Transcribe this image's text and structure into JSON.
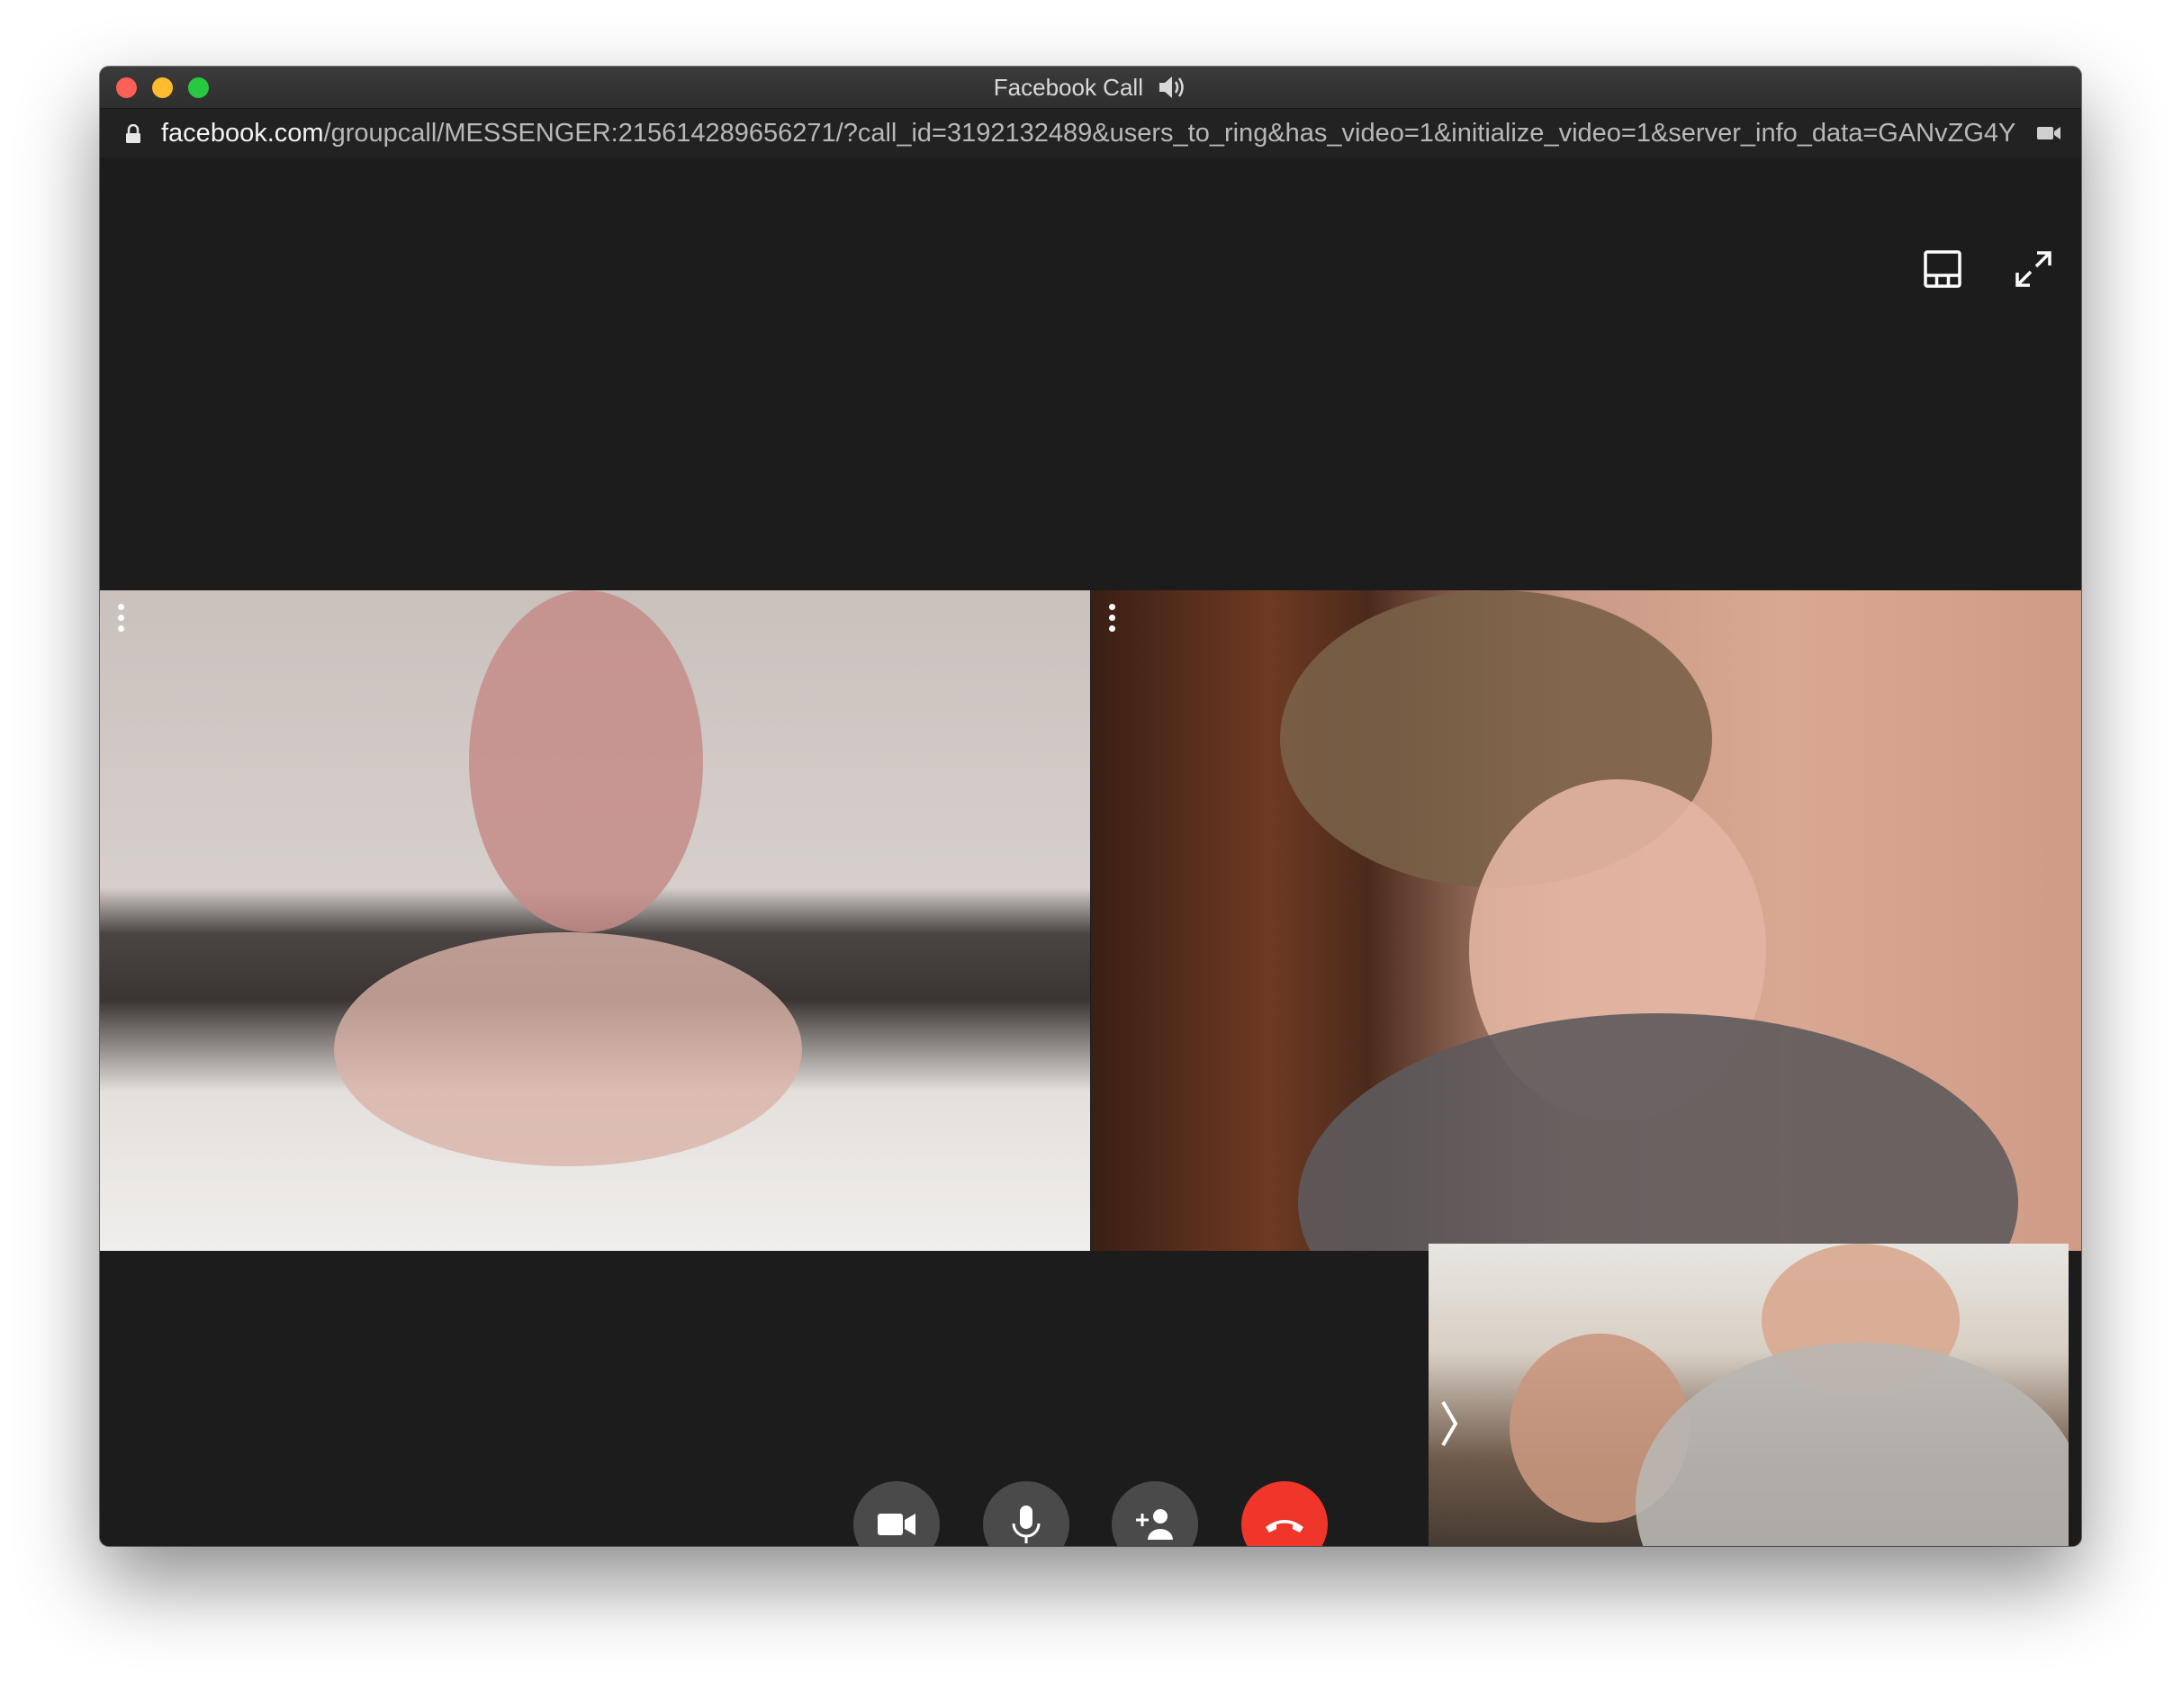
{
  "window": {
    "title": "Facebook Call",
    "title_icon": "speaker-icon"
  },
  "address_bar": {
    "lock_icon": "lock-icon",
    "host": "facebook.com",
    "path": "/groupcall/MESSENGER:215614289656271/?call_id=3192132489&users_to_ring&has_video=1&initialize_video=1&server_info_data=GANvZG4YGU1...",
    "camera_icon": "camera-icon"
  },
  "top_controls": {
    "layout_icon": "layout-icon",
    "fullscreen_icon": "expand-icon"
  },
  "participants": [
    {
      "menu_icon": "more-vertical-icon"
    },
    {
      "menu_icon": "more-vertical-icon"
    },
    {
      "expand_icon": "chevron-right-icon"
    }
  ],
  "call_controls": {
    "video_icon": "video-camera-icon",
    "mic_icon": "microphone-icon",
    "add_person_icon": "add-person-icon",
    "end_call_icon": "hang-up-icon",
    "end_call_color": "#f0352b",
    "button_color": "#4a4a4a"
  },
  "colors": {
    "stage_background": "#1c1c1c",
    "traffic_close": "#fe5f57",
    "traffic_minimize": "#febc2e",
    "traffic_maximize": "#28c840"
  }
}
